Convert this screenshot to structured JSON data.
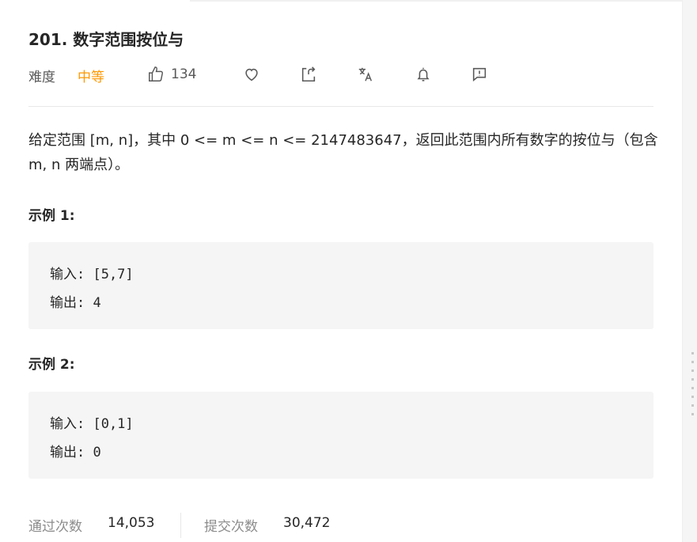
{
  "problem": {
    "title": "201. 数字范围按位与",
    "difficulty_label": "难度",
    "difficulty": "中等",
    "likes": "134",
    "description": "给定范围 [m, n]，其中 0 <= m <= n <= 2147483647，返回此范围内所有数字的按位与（包含 m, n 两端点）。"
  },
  "actions": {
    "icons": [
      "thumbs-up-icon",
      "heart-icon",
      "share-icon",
      "translate-icon",
      "bell-icon",
      "feedback-icon"
    ]
  },
  "examples": [
    {
      "title": "示例 1:",
      "input_line": "输入: [5,7]",
      "output_line": "输出: 4"
    },
    {
      "title": "示例 2:",
      "input_line": "输入: [0,1]",
      "output_line": "输出: 0"
    }
  ],
  "stats": {
    "accepted_label": "通过次数",
    "accepted_value": "14,053",
    "submitted_label": "提交次数",
    "submitted_value": "30,472"
  },
  "colors": {
    "difficulty_medium": "#ff9800",
    "code_background": "#f5f5f5",
    "muted_text": "#8c8c8c"
  }
}
